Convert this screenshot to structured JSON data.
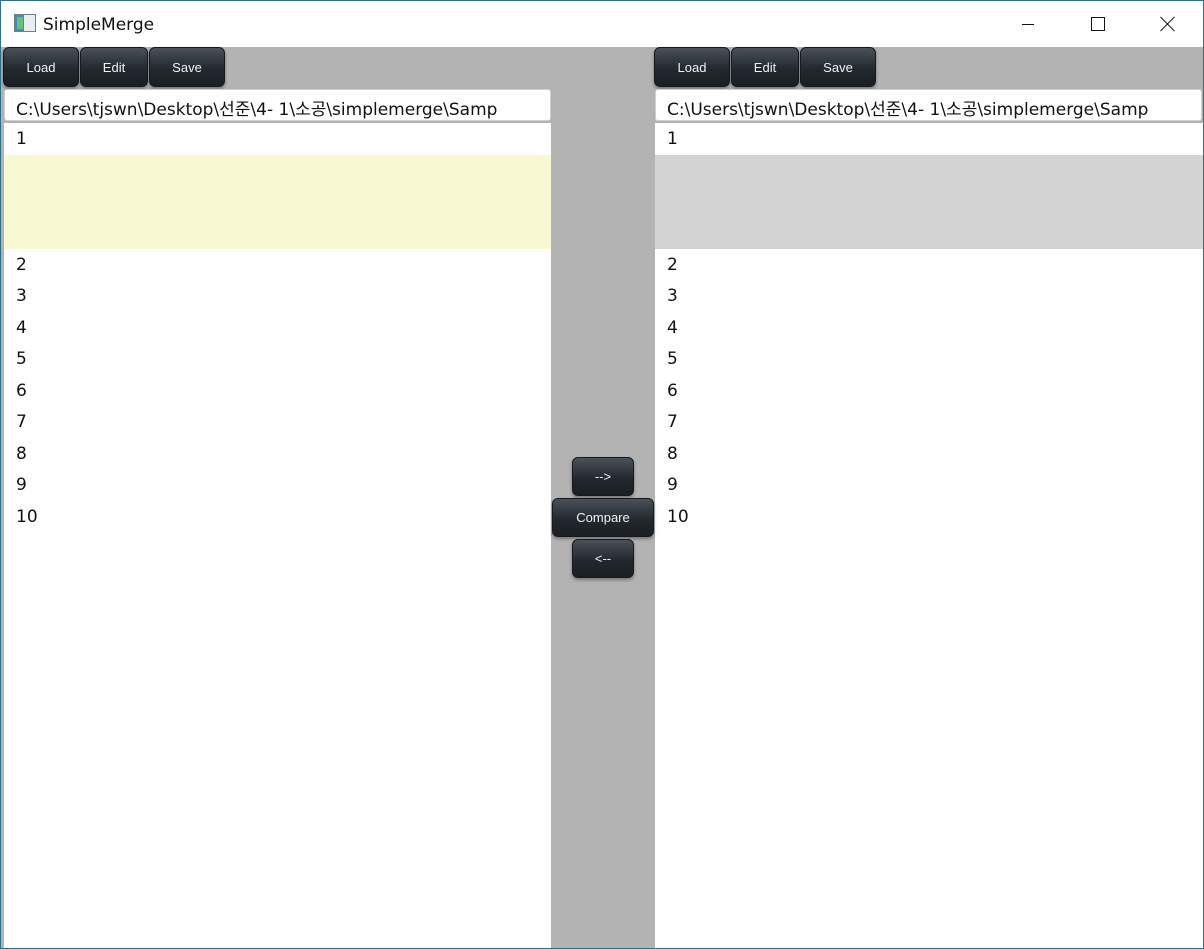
{
  "window": {
    "title": "SimpleMerge"
  },
  "left": {
    "buttons": {
      "load": "Load",
      "edit": "Edit",
      "save": "Save"
    },
    "path": "C:\\Users\\tjswn\\Desktop\\선준\\4- 1\\소공\\simplemerge\\Samp",
    "lines": [
      "1",
      "2",
      "3",
      "4",
      "5",
      "6",
      "7",
      "8",
      "9",
      "10"
    ]
  },
  "right": {
    "buttons": {
      "load": "Load",
      "edit": "Edit",
      "save": "Save"
    },
    "path": "C:\\Users\\tjswn\\Desktop\\선준\\4- 1\\소공\\simplemerge\\Samp",
    "lines": [
      "1",
      "2",
      "3",
      "4",
      "5",
      "6",
      "7",
      "8",
      "9",
      "10"
    ]
  },
  "center": {
    "copy_right": "-->",
    "compare": "Compare",
    "copy_left": "<--"
  },
  "colors": {
    "diff_left": "#f8f8d2",
    "diff_right": "#d3d3d3",
    "background": "#b3b3b3"
  }
}
